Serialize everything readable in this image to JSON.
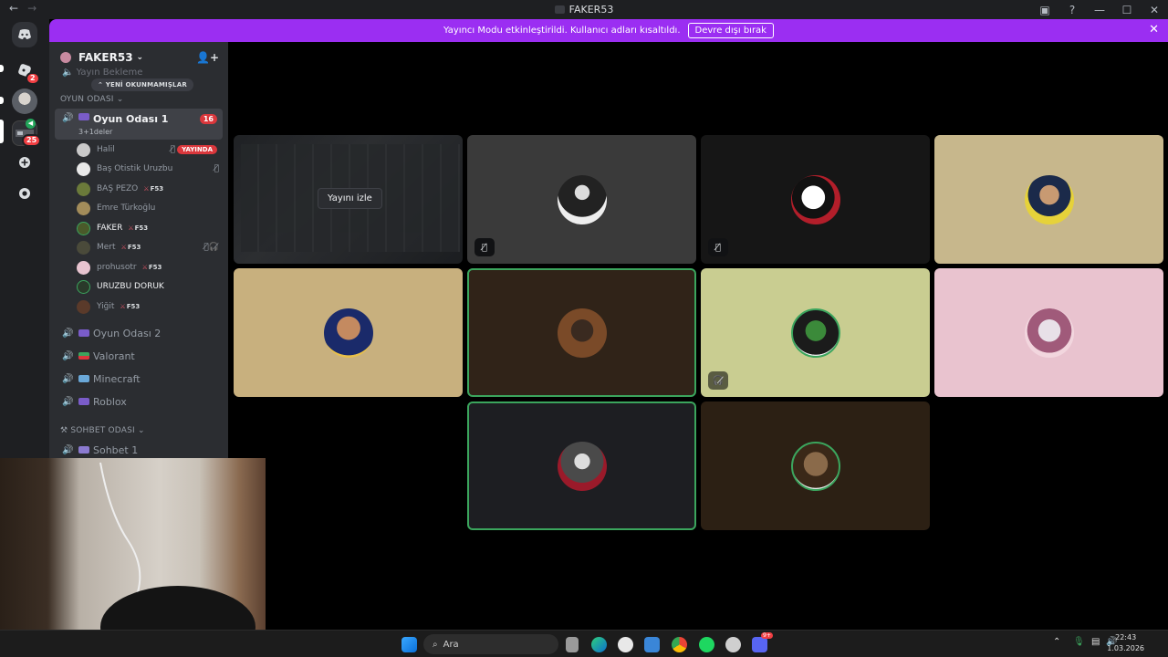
{
  "window": {
    "title": "FAKER53"
  },
  "banner": {
    "text": "Yayıncı Modu etkinleştirildi. Kullanıcı adları kısaltıldı.",
    "button": "Devre dışı bırak"
  },
  "rail": {
    "badges": [
      "2",
      "25"
    ]
  },
  "server": {
    "name": "FAKER53"
  },
  "sidebar": {
    "faded_channel": "Yayın Bekleme",
    "new_unread": "YENİ OKUNMAMIŞLAR",
    "category_game": "OYUN ODASI",
    "active_channel": {
      "name": "Oyun Odası 1",
      "sub": "3+1deler",
      "count": "16"
    },
    "users": [
      {
        "name": "Halil",
        "live": "YAYINDA"
      },
      {
        "name": "Baş Otistik Uruzbu"
      },
      {
        "name": "BAŞ PEZO",
        "tag": "F53"
      },
      {
        "name": "Emre Türkoğlu"
      },
      {
        "name": "FAKER",
        "tag": "F53"
      },
      {
        "name": "Mert",
        "tag": "F53"
      },
      {
        "name": "prohusotr",
        "tag": "F53"
      },
      {
        "name": "URUZBU DORUK"
      },
      {
        "name": "Yiğit",
        "tag": "F53"
      }
    ],
    "channels": [
      "Oyun Odası 2",
      "Valorant",
      "Minecraft",
      "Roblox"
    ],
    "category_chat": "SOHBET ODASI",
    "chat_channel": "Sohbet 1"
  },
  "stage": {
    "watch_label": "Yayını izle"
  },
  "taskbar": {
    "search_placeholder": "Ara",
    "time": "22:43",
    "date": "1.03.2026",
    "discord_badge": "9+"
  },
  "colors": {
    "banner": "#9b2ef2",
    "speaking": "#3ba55d",
    "live_badge": "#da373c"
  }
}
